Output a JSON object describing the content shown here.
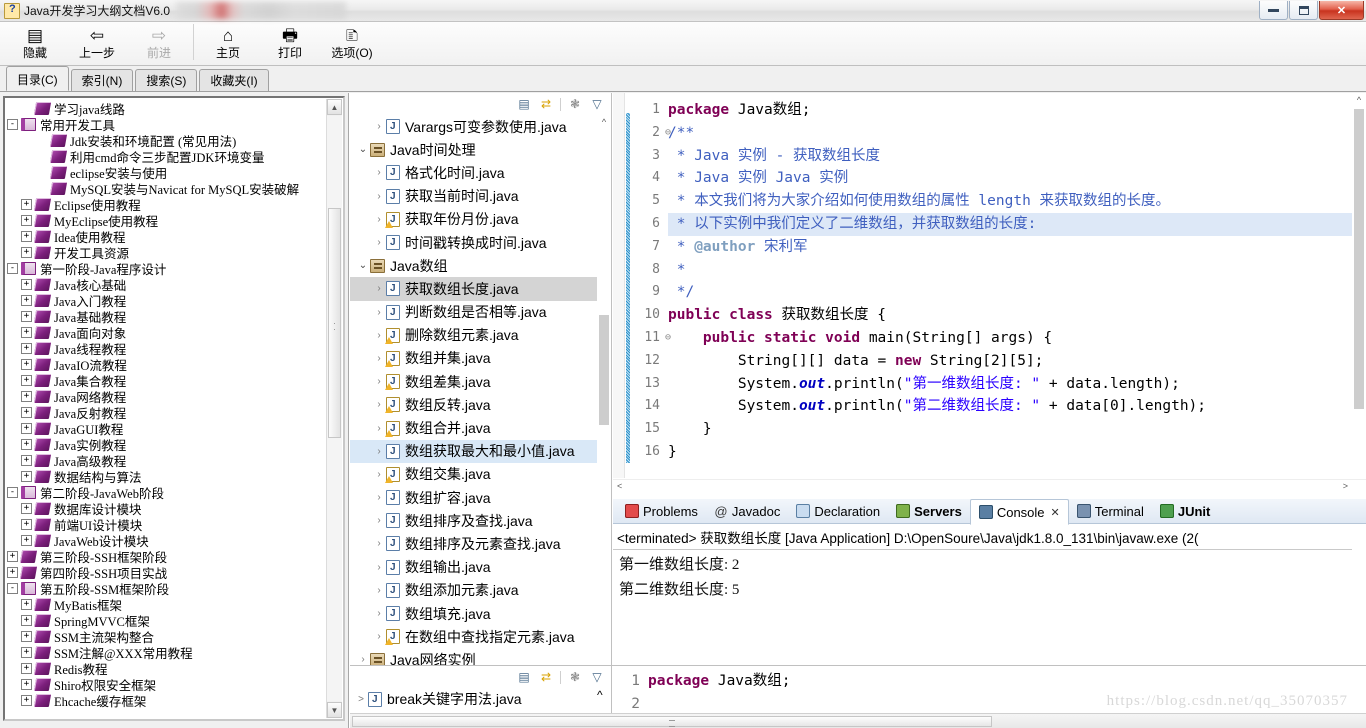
{
  "window": {
    "title": "Java开发学习大纲文档V6.0",
    "icon": "help-book-icon",
    "controls": {
      "minimize": "minimize",
      "restore": "restore",
      "close": "✕"
    }
  },
  "help_toolbar": {
    "buttons": [
      {
        "label": "隐藏",
        "icon": "hide-panel-icon",
        "disabled": false
      },
      {
        "label": "上一步",
        "icon": "back-arrow-icon",
        "disabled": false
      },
      {
        "label": "前进",
        "icon": "forward-arrow-icon",
        "disabled": true
      },
      {
        "label": "主页",
        "icon": "home-icon",
        "disabled": false
      },
      {
        "label": "打印",
        "icon": "printer-icon",
        "disabled": false
      },
      {
        "label": "选项(O)",
        "icon": "options-icon",
        "disabled": false
      }
    ]
  },
  "help_tabs": {
    "items": [
      {
        "label": "目录(C)",
        "active": true
      },
      {
        "label": "索引(N)",
        "active": false
      },
      {
        "label": "搜索(S)",
        "active": false
      },
      {
        "label": "收藏夹(I)",
        "active": false
      }
    ]
  },
  "help_tree": {
    "rows": [
      {
        "label": "学习java线路",
        "indent": 1,
        "expander": "none",
        "icon": "book-node-icon"
      },
      {
        "label": "常用开发工具",
        "indent": 0,
        "expander": "-",
        "icon": "book-folder-icon"
      },
      {
        "label": "Jdk安装和环境配置 (常见用法)",
        "indent": 2,
        "expander": "none",
        "icon": "book-node-icon"
      },
      {
        "label": "利用cmd命令三步配置JDK环境变量",
        "indent": 2,
        "expander": "none",
        "icon": "book-node-icon"
      },
      {
        "label": "eclipse安装与使用",
        "indent": 2,
        "expander": "none",
        "icon": "book-node-icon"
      },
      {
        "label": "MySQL安装与Navicat for MySQL安装破解",
        "indent": 2,
        "expander": "none",
        "icon": "book-node-icon"
      },
      {
        "label": "Eclipse使用教程",
        "indent": 1,
        "expander": "+",
        "icon": "book-node-icon"
      },
      {
        "label": "MyEclipse使用教程",
        "indent": 1,
        "expander": "+",
        "icon": "book-node-icon"
      },
      {
        "label": "Idea使用教程",
        "indent": 1,
        "expander": "+",
        "icon": "book-node-icon"
      },
      {
        "label": "开发工具资源",
        "indent": 1,
        "expander": "+",
        "icon": "book-node-icon"
      },
      {
        "label": "第一阶段-Java程序设计",
        "indent": 0,
        "expander": "-",
        "icon": "book-folder-icon"
      },
      {
        "label": "Java核心基础",
        "indent": 1,
        "expander": "+",
        "icon": "book-node-icon"
      },
      {
        "label": "Java入门教程",
        "indent": 1,
        "expander": "+",
        "icon": "book-node-icon"
      },
      {
        "label": "Java基础教程",
        "indent": 1,
        "expander": "+",
        "icon": "book-node-icon"
      },
      {
        "label": "Java面向对象",
        "indent": 1,
        "expander": "+",
        "icon": "book-node-icon"
      },
      {
        "label": "Java线程教程",
        "indent": 1,
        "expander": "+",
        "icon": "book-node-icon"
      },
      {
        "label": "JavaIO流教程",
        "indent": 1,
        "expander": "+",
        "icon": "book-node-icon"
      },
      {
        "label": "Java集合教程",
        "indent": 1,
        "expander": "+",
        "icon": "book-node-icon"
      },
      {
        "label": "Java网络教程",
        "indent": 1,
        "expander": "+",
        "icon": "book-node-icon"
      },
      {
        "label": "Java反射教程",
        "indent": 1,
        "expander": "+",
        "icon": "book-node-icon"
      },
      {
        "label": "JavaGUI教程",
        "indent": 1,
        "expander": "+",
        "icon": "book-node-icon"
      },
      {
        "label": "Java实例教程",
        "indent": 1,
        "expander": "+",
        "icon": "book-node-icon"
      },
      {
        "label": "Java高级教程",
        "indent": 1,
        "expander": "+",
        "icon": "book-node-icon"
      },
      {
        "label": "数据结构与算法",
        "indent": 1,
        "expander": "+",
        "icon": "book-node-icon"
      },
      {
        "label": "第二阶段-JavaWeb阶段",
        "indent": 0,
        "expander": "-",
        "icon": "book-folder-icon"
      },
      {
        "label": "数据库设计模块",
        "indent": 1,
        "expander": "+",
        "icon": "book-node-icon"
      },
      {
        "label": "前端UI设计模块",
        "indent": 1,
        "expander": "+",
        "icon": "book-node-icon"
      },
      {
        "label": "JavaWeb设计模块",
        "indent": 1,
        "expander": "+",
        "icon": "book-node-icon"
      },
      {
        "label": "第三阶段-SSH框架阶段",
        "indent": 0,
        "expander": "+",
        "icon": "book-node-icon"
      },
      {
        "label": "第四阶段-SSH项目实战",
        "indent": 0,
        "expander": "+",
        "icon": "book-node-icon"
      },
      {
        "label": "第五阶段-SSM框架阶段",
        "indent": 0,
        "expander": "-",
        "icon": "book-folder-icon"
      },
      {
        "label": "MyBatis框架",
        "indent": 1,
        "expander": "+",
        "icon": "book-node-icon"
      },
      {
        "label": "SpringMVVC框架",
        "indent": 1,
        "expander": "+",
        "icon": "book-node-icon"
      },
      {
        "label": "SSM主流架构整合",
        "indent": 1,
        "expander": "+",
        "icon": "book-node-icon"
      },
      {
        "label": "SSM注解@XXX常用教程",
        "indent": 1,
        "expander": "+",
        "icon": "book-node-icon"
      },
      {
        "label": "Redis教程",
        "indent": 1,
        "expander": "+",
        "icon": "book-node-icon"
      },
      {
        "label": "Shiro权限安全框架",
        "indent": 1,
        "expander": "+",
        "icon": "book-node-icon"
      },
      {
        "label": "Ehcache缓存框架",
        "indent": 1,
        "expander": "+",
        "icon": "book-node-icon"
      }
    ]
  },
  "package_explorer": {
    "toolbar": [
      {
        "icon": "collapse-all-icon"
      },
      {
        "icon": "link-with-editor-icon"
      },
      {
        "icon": "view-menu-icon"
      },
      {
        "icon": "minimize-view-icon"
      }
    ],
    "rows": [
      {
        "label": "Varargs可变参数使用.java",
        "indent": 2,
        "arrow": ">",
        "icon": "java-file-icon",
        "state": ""
      },
      {
        "label": "Java时间处理",
        "indent": 1,
        "arrow": "v",
        "icon": "package-icon",
        "state": ""
      },
      {
        "label": "格式化时间.java",
        "indent": 2,
        "arrow": ">",
        "icon": "java-file-icon",
        "state": ""
      },
      {
        "label": "获取当前时间.java",
        "indent": 2,
        "arrow": ">",
        "icon": "java-file-icon",
        "state": ""
      },
      {
        "label": "获取年份月份.java",
        "indent": 2,
        "arrow": ">",
        "icon": "java-file-warn-icon",
        "state": ""
      },
      {
        "label": "时间戳转换成时间.java",
        "indent": 2,
        "arrow": ">",
        "icon": "java-file-icon",
        "state": ""
      },
      {
        "label": "Java数组",
        "indent": 1,
        "arrow": "v",
        "icon": "package-icon",
        "state": ""
      },
      {
        "label": "获取数组长度.java",
        "indent": 2,
        "arrow": ">",
        "icon": "java-file-icon",
        "state": "selected"
      },
      {
        "label": "判断数组是否相等.java",
        "indent": 2,
        "arrow": ">",
        "icon": "java-file-icon",
        "state": ""
      },
      {
        "label": "删除数组元素.java",
        "indent": 2,
        "arrow": ">",
        "icon": "java-file-warn-icon",
        "state": ""
      },
      {
        "label": "数组并集.java",
        "indent": 2,
        "arrow": ">",
        "icon": "java-file-warn-icon",
        "state": ""
      },
      {
        "label": "数组差集.java",
        "indent": 2,
        "arrow": ">",
        "icon": "java-file-warn-icon",
        "state": ""
      },
      {
        "label": "数组反转.java",
        "indent": 2,
        "arrow": ">",
        "icon": "java-file-warn-icon",
        "state": ""
      },
      {
        "label": "数组合并.java",
        "indent": 2,
        "arrow": ">",
        "icon": "java-file-warn-icon",
        "state": ""
      },
      {
        "label": "数组获取最大和最小值.java",
        "indent": 2,
        "arrow": ">",
        "icon": "java-file-icon",
        "state": "highlight"
      },
      {
        "label": "数组交集.java",
        "indent": 2,
        "arrow": ">",
        "icon": "java-file-warn-icon",
        "state": ""
      },
      {
        "label": "数组扩容.java",
        "indent": 2,
        "arrow": ">",
        "icon": "java-file-icon",
        "state": ""
      },
      {
        "label": "数组排序及查找.java",
        "indent": 2,
        "arrow": ">",
        "icon": "java-file-icon",
        "state": ""
      },
      {
        "label": "数组排序及元素查找.java",
        "indent": 2,
        "arrow": ">",
        "icon": "java-file-icon",
        "state": ""
      },
      {
        "label": "数组输出.java",
        "indent": 2,
        "arrow": ">",
        "icon": "java-file-icon",
        "state": ""
      },
      {
        "label": "数组添加元素.java",
        "indent": 2,
        "arrow": ">",
        "icon": "java-file-icon",
        "state": ""
      },
      {
        "label": "数组填充.java",
        "indent": 2,
        "arrow": ">",
        "icon": "java-file-icon",
        "state": ""
      },
      {
        "label": "在数组中查找指定元素.java",
        "indent": 2,
        "arrow": ">",
        "icon": "java-file-warn-icon",
        "state": ""
      },
      {
        "label": "Java网络实例",
        "indent": 1,
        "arrow": ">",
        "icon": "package-icon",
        "state": ""
      }
    ]
  },
  "editor": {
    "line_numbers": [
      "1",
      "2",
      "3",
      "4",
      "5",
      "6",
      "7",
      "8",
      "9",
      "10",
      "11",
      "12",
      "13",
      "14",
      "15",
      "16"
    ],
    "folded_lines": [
      "2",
      "11"
    ],
    "highlighted_line": 6,
    "lines": [
      "package Java数组;",
      "/**",
      " * Java 实例 - 获取数组长度",
      " * Java 实例 Java 实例",
      " * 本文我们将为大家介绍如何使用数组的属性 length 来获取数组的长度。",
      " * 以下实例中我们定义了二维数组，并获取数组的长度:",
      " * @author 宋利军",
      " *",
      " */",
      "public class 获取数组长度 {",
      "    public static void main(String[] args) {",
      "        String[][] data = new String[2][5];",
      "        System.out.println(\"第一维数组长度: \" + data.length);",
      "        System.out.println(\"第二维数组长度: \" + data[0].length);",
      "    }",
      "}"
    ]
  },
  "console_panel": {
    "tabs": [
      {
        "label": "Problems",
        "icon": "problems-icon",
        "active": false,
        "bold": false,
        "closable": false
      },
      {
        "label": "Javadoc",
        "icon": "javadoc-icon",
        "active": false,
        "bold": false,
        "closable": false
      },
      {
        "label": "Declaration",
        "icon": "declaration-icon",
        "active": false,
        "bold": false,
        "closable": false
      },
      {
        "label": "Servers",
        "icon": "servers-icon",
        "active": false,
        "bold": true,
        "closable": false
      },
      {
        "label": "Console",
        "icon": "console-icon",
        "active": true,
        "bold": false,
        "closable": true
      },
      {
        "label": "Terminal",
        "icon": "terminal-icon",
        "active": false,
        "bold": false,
        "closable": false
      },
      {
        "label": "JUnit",
        "icon": "junit-icon",
        "active": false,
        "bold": true,
        "closable": false
      }
    ],
    "close_glyph": "✕",
    "header": "<terminated> 获取数组长度 [Java Application] D:\\OpenSoure\\Java\\jdk1.8.0_131\\bin\\javaw.exe (2(",
    "output": [
      "第一维数组长度: 2",
      "第二维数组长度: 5"
    ]
  },
  "bottom_strip": {
    "tree_row": {
      "label": "break关键字用法.java",
      "arrow": ">",
      "icon": "java-file-icon"
    },
    "code_lines": [
      {
        "num": "1",
        "text": "package Java数组;"
      },
      {
        "num": "2",
        "text": ""
      }
    ]
  },
  "watermark": {
    "text": "https://blog.csdn.net/qq_35070357"
  },
  "colors": {
    "keyword": "#7f0055",
    "comment": "#3f5fbf",
    "string": "#2a00ff",
    "field": "#0000c0",
    "selection": "#d4d4d4",
    "line_highlight": "#dde8f7",
    "accent_close": "#c8331f"
  }
}
